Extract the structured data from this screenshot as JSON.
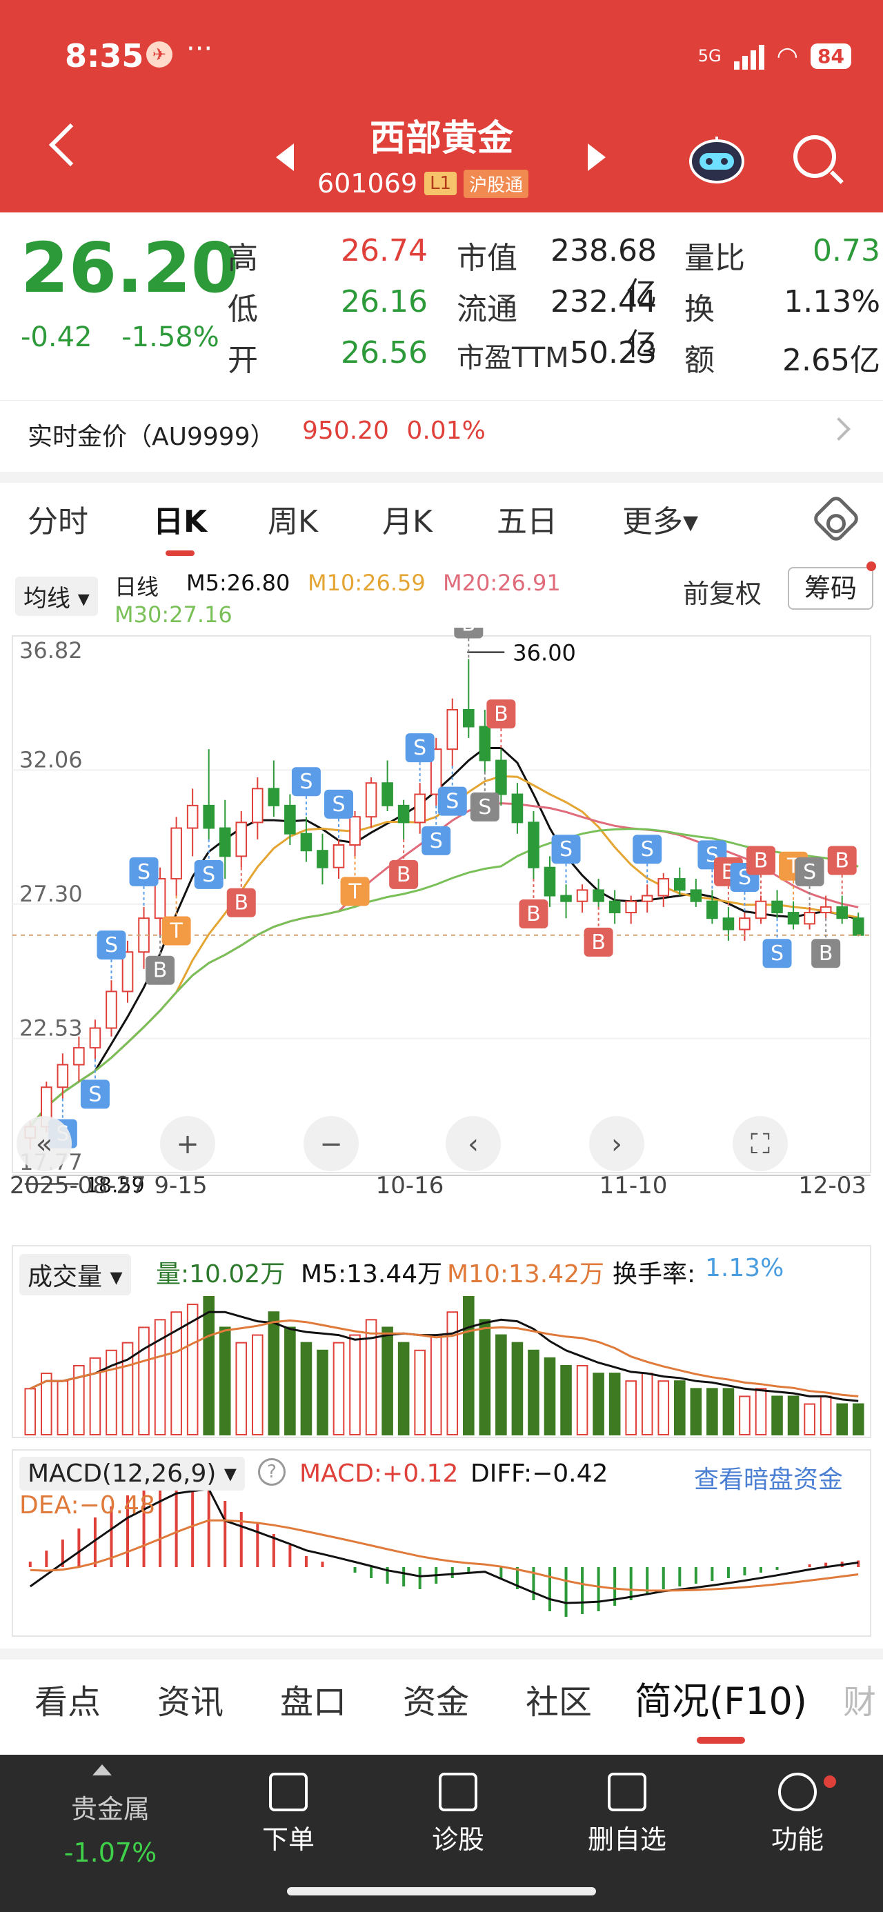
{
  "status": {
    "time": "8:35",
    "network": "5G",
    "battery": "84"
  },
  "header": {
    "title": "西部黄金",
    "code": "601069",
    "level": "L1",
    "connect": "沪股通"
  },
  "quote": {
    "price": "26.20",
    "change": "-0.42",
    "change_pct": "-1.58%",
    "high_label": "高",
    "high": "26.74",
    "low_label": "低",
    "low": "26.16",
    "open_label": "开",
    "open": "26.56",
    "mcap_label": "市值",
    "mcap": "238.68亿",
    "float_label": "流通",
    "float": "232.44亿",
    "pe_label": "市盈TTM",
    "pe": "50.23",
    "vol_ratio_label": "量比",
    "vol_ratio": "0.73",
    "turnover_label": "换",
    "turnover": "1.13%",
    "amount_label": "额",
    "amount": "2.65亿"
  },
  "gold": {
    "label": "实时金价（AU9999）",
    "price": "950.20",
    "pct": "0.01%"
  },
  "chart_tabs": [
    "分时",
    "日K",
    "周K",
    "月K",
    "五日",
    "更多▾"
  ],
  "ma": {
    "select": "均线 ▾",
    "period": "日线",
    "m5": "M5:26.80",
    "m10": "M10:26.59",
    "m20": "M20:26.91",
    "m30": "M30:27.16",
    "adjust": "前复权",
    "chips": "筹码"
  },
  "colors": {
    "up": "#e0403a",
    "down": "#2d9a3a",
    "m5": "#111111",
    "m10": "#e4a533",
    "m20": "#e06b7a",
    "m30": "#7ac058",
    "buy": "#e0605a",
    "sell": "#5a9ce8",
    "t": "#f39a45",
    "gray": "#888888"
  },
  "kline": {
    "y_ticks": [
      "36.82",
      "32.06",
      "27.30",
      "22.53",
      "17.77"
    ],
    "high_note": "36.00",
    "low_note": "18.59",
    "x_ticks": [
      "2025-08-27",
      "9-15",
      "10-16",
      "11-10",
      "12-03"
    ]
  },
  "volume": {
    "select": "成交量 ▾",
    "vol": "量:10.02万",
    "m5": "M5:13.44万",
    "m10": "M10:13.42万",
    "turnover_label": "换手率:",
    "turnover": "1.13%"
  },
  "macd": {
    "select": "MACD(12,26,9) ▾",
    "help": "?",
    "macd": "MACD:+0.12",
    "diff": "DIFF:−0.42",
    "dea": "DEA:−0.48",
    "link": "查看暗盘资金"
  },
  "bottom_tabs": [
    "看点",
    "资讯",
    "盘口",
    "资金",
    "社区",
    "简况(F10)",
    "财"
  ],
  "bottom_bar": {
    "sector": "贵金属",
    "sector_pct": "-1.07%",
    "items": [
      "下单",
      "诊股",
      "删自选",
      "功能"
    ]
  },
  "chart_data": [
    {
      "type": "candlestick",
      "title": "",
      "y_ticks": [
        36.82,
        32.06,
        27.3,
        22.53,
        17.77
      ],
      "ylim": [
        17.77,
        36.82
      ],
      "x_ticks": [
        "2025-08-27",
        "9-15",
        "10-16",
        "11-10",
        "12-03"
      ],
      "ohlc": [
        [
          19.0,
          19.6,
          18.59,
          19.4
        ],
        [
          19.4,
          21.0,
          19.2,
          20.8
        ],
        [
          20.8,
          22.0,
          20.4,
          21.6
        ],
        [
          21.6,
          22.6,
          21.0,
          22.2
        ],
        [
          22.2,
          23.2,
          21.8,
          22.9
        ],
        [
          22.9,
          24.6,
          22.6,
          24.2
        ],
        [
          24.2,
          26.0,
          23.8,
          25.6
        ],
        [
          25.6,
          27.2,
          25.0,
          26.8
        ],
        [
          26.8,
          28.6,
          26.2,
          28.2
        ],
        [
          28.2,
          30.4,
          27.6,
          30.0
        ],
        [
          30.0,
          31.4,
          29.0,
          30.8
        ],
        [
          30.8,
          32.8,
          29.6,
          30.0
        ],
        [
          30.0,
          31.0,
          28.2,
          29.0
        ],
        [
          29.0,
          30.6,
          28.6,
          30.2
        ],
        [
          30.2,
          31.8,
          29.6,
          31.4
        ],
        [
          31.4,
          32.4,
          30.4,
          30.8
        ],
        [
          30.8,
          31.2,
          29.4,
          29.8
        ],
        [
          29.8,
          30.4,
          28.8,
          29.2
        ],
        [
          29.2,
          29.8,
          28.0,
          28.6
        ],
        [
          28.6,
          29.6,
          28.2,
          29.4
        ],
        [
          29.4,
          30.6,
          29.0,
          30.4
        ],
        [
          30.4,
          31.8,
          30.0,
          31.6
        ],
        [
          31.6,
          32.4,
          30.6,
          30.8
        ],
        [
          30.8,
          31.0,
          29.6,
          30.2
        ],
        [
          30.2,
          31.6,
          29.8,
          31.2
        ],
        [
          31.2,
          33.2,
          30.8,
          32.8
        ],
        [
          32.8,
          34.6,
          32.2,
          34.2
        ],
        [
          34.2,
          36.0,
          33.2,
          33.6
        ],
        [
          33.6,
          34.2,
          32.0,
          32.4
        ],
        [
          32.4,
          32.8,
          30.8,
          31.2
        ],
        [
          31.2,
          31.6,
          29.8,
          30.2
        ],
        [
          30.2,
          30.6,
          28.2,
          28.6
        ],
        [
          28.6,
          29.0,
          27.2,
          27.6
        ],
        [
          27.6,
          28.0,
          26.8,
          27.4
        ],
        [
          27.4,
          28.0,
          27.0,
          27.8
        ],
        [
          27.8,
          28.2,
          27.2,
          27.4
        ],
        [
          27.4,
          27.8,
          26.6,
          27.0
        ],
        [
          27.0,
          27.6,
          26.6,
          27.4
        ],
        [
          27.4,
          28.0,
          27.0,
          27.6
        ],
        [
          27.6,
          28.4,
          27.2,
          28.2
        ],
        [
          28.2,
          28.6,
          27.6,
          27.8
        ],
        [
          27.8,
          28.2,
          27.2,
          27.4
        ],
        [
          27.4,
          27.8,
          26.6,
          26.8
        ],
        [
          26.8,
          27.2,
          26.0,
          26.4
        ],
        [
          26.4,
          27.0,
          26.0,
          26.8
        ],
        [
          26.8,
          27.6,
          26.6,
          27.4
        ],
        [
          27.4,
          27.8,
          26.8,
          27.0
        ],
        [
          27.0,
          27.4,
          26.4,
          26.6
        ],
        [
          26.6,
          27.2,
          26.4,
          27.0
        ],
        [
          27.0,
          27.6,
          26.8,
          27.2
        ],
        [
          27.2,
          27.6,
          26.6,
          26.8
        ],
        [
          26.8,
          27.0,
          26.16,
          26.2
        ]
      ]
    },
    {
      "type": "bar",
      "title": "成交量",
      "series": [
        {
          "name": "量",
          "values": [
            6,
            8,
            7,
            9,
            10,
            11,
            12,
            14,
            15,
            16,
            17,
            18,
            14,
            12,
            13,
            16,
            14,
            12,
            11,
            12,
            13,
            15,
            14,
            12,
            11,
            13,
            16,
            18,
            15,
            13,
            12,
            11,
            10,
            9,
            9,
            8,
            8,
            7,
            8,
            7,
            7,
            6,
            6,
            6,
            5,
            6,
            5,
            5,
            4,
            5,
            4,
            4
          ]
        }
      ]
    },
    {
      "type": "bar",
      "title": "MACD(12,26,9)",
      "series": [
        {
          "name": "MACD",
          "values": [
            0.1,
            0.3,
            0.5,
            0.7,
            0.9,
            1.1,
            1.3,
            1.4,
            1.5,
            1.6,
            1.5,
            1.4,
            1.2,
            1.0,
            0.8,
            0.6,
            0.4,
            0.2,
            0.1,
            0.0,
            -0.1,
            -0.2,
            -0.3,
            -0.35,
            -0.4,
            -0.3,
            -0.2,
            -0.1,
            0.0,
            -0.2,
            -0.4,
            -0.6,
            -0.8,
            -0.9,
            -0.85,
            -0.8,
            -0.7,
            -0.6,
            -0.5,
            -0.4,
            -0.35,
            -0.3,
            -0.25,
            -0.2,
            -0.15,
            -0.1,
            -0.05,
            0.0,
            0.05,
            0.08,
            0.1,
            0.12
          ]
        }
      ]
    }
  ]
}
